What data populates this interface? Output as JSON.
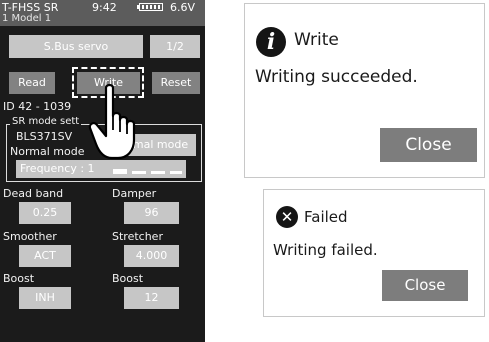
{
  "radio": {
    "header": {
      "system": "T-FHSS SR",
      "model": "1  Model 1",
      "time": "9:42",
      "voltage": "6.6V"
    },
    "servo_type": "S.Bus servo",
    "page_indicator": "1/2",
    "buttons": {
      "read": "Read",
      "write": "Write",
      "reset": "Reset"
    },
    "id_line": "ID  42  -  1039",
    "sr_mode": {
      "title": "SR mode sett",
      "servo_model": "BLS371SV",
      "current_mode": "Normal mode",
      "mode_button": "ormal mode",
      "frequency": "Frequency : 1"
    },
    "params": {
      "dead_band": {
        "label": "Dead band",
        "value": "0.25"
      },
      "damper": {
        "label": "Damper",
        "value": "96"
      },
      "smoother": {
        "label": "Smoother",
        "value": "ACT"
      },
      "stretcher": {
        "label": "Stretcher",
        "value": "4.000"
      },
      "boost": {
        "label": "Boost",
        "value": "INH"
      },
      "boost2": {
        "label": "Boost",
        "value": "12"
      }
    }
  },
  "dialog_success": {
    "icon": "info-icon",
    "title": "Write",
    "message": "Writing succeeded.",
    "close": "Close"
  },
  "dialog_failed": {
    "icon": "error-x-icon",
    "title": "Failed",
    "message": "Writing failed.",
    "close": "Close"
  }
}
